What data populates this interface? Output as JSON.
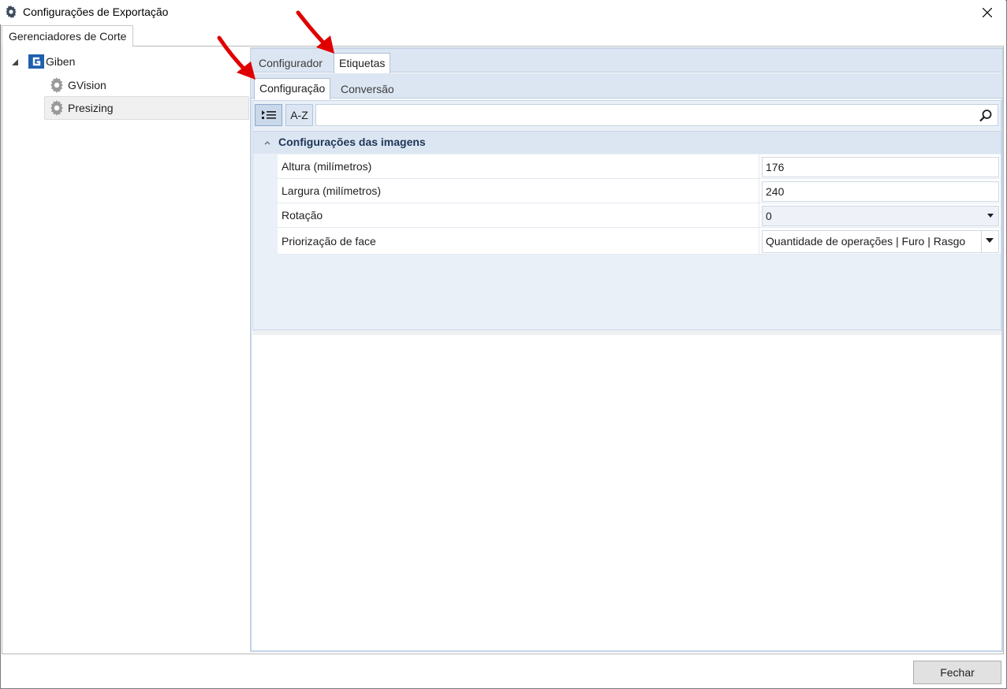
{
  "window": {
    "title": "Configurações de Exportação",
    "close_icon": "close-icon"
  },
  "outer_tab": {
    "label": "Gerenciadores de Corte"
  },
  "tree": {
    "root": {
      "label": "Giben",
      "icon": "giben-logo-icon"
    },
    "children": [
      {
        "label": "GVision",
        "icon": "gear-icon"
      },
      {
        "label": "Presizing",
        "icon": "gear-icon",
        "selected": true
      }
    ]
  },
  "tabs": [
    {
      "label": "Configurador"
    },
    {
      "label": "Etiquetas",
      "active": true
    }
  ],
  "subtabs": [
    {
      "label": "Configuração",
      "active": true
    },
    {
      "label": "Conversão"
    }
  ],
  "toolbar": {
    "categorized_icon": "categorized-list-icon",
    "az_label": "A-Z",
    "search_placeholder": "",
    "search_icon": "search-icon"
  },
  "category": {
    "title": "Configurações das imagens",
    "properties": [
      {
        "label": "Altura (milímetros)",
        "value": "176",
        "type": "text"
      },
      {
        "label": "Largura (milímetros)",
        "value": "240",
        "type": "text"
      },
      {
        "label": "Rotação",
        "value": "0",
        "type": "dropdown"
      },
      {
        "label": "Priorização de face",
        "value": "Quantidade de operações | Furo | Rasgo",
        "type": "dropdown"
      }
    ]
  },
  "footer": {
    "close_label": "Fechar"
  },
  "colors": {
    "accent_bg": "#dce6f2",
    "annotation_arrow": "#e00000"
  }
}
